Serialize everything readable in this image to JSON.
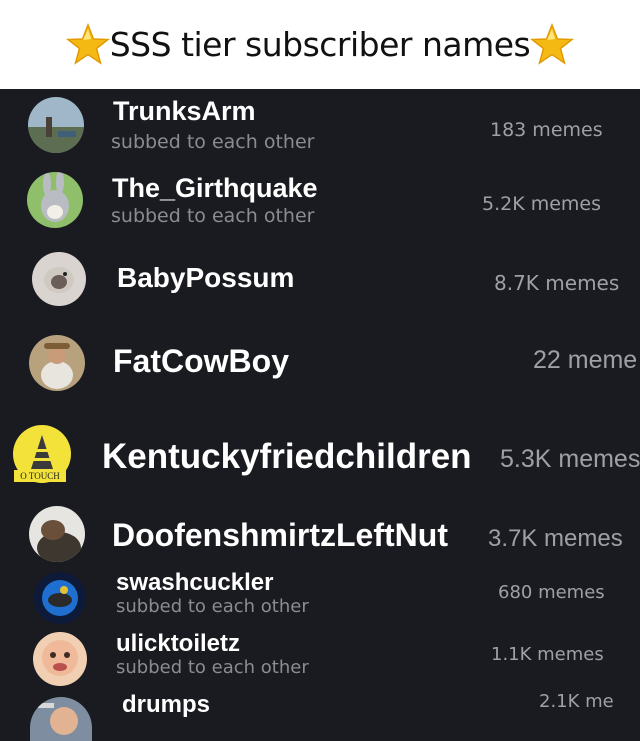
{
  "header": {
    "title": "SSS tier subscriber names"
  },
  "subscribers": [
    {
      "name": "TrunksArm",
      "subtitle": "subbed to each other",
      "count": "183 memes"
    },
    {
      "name": "The_Girthquake",
      "subtitle": "subbed to each other",
      "count": "5.2K memes"
    },
    {
      "name": "BabyPossum",
      "count": "8.7K memes"
    },
    {
      "name": "FatCowBoy",
      "count": "22 meme"
    },
    {
      "name": "Kentuckyfriedchildren",
      "count": "5.3K memes",
      "avatar_text": "O TOUCH"
    },
    {
      "name": "DoofenshmirtzLeftNut",
      "count": "3.7K memes"
    },
    {
      "name": "swashcuckler",
      "subtitle": "subbed to each other",
      "count": "680 memes"
    },
    {
      "name": "ulicktoiletz",
      "subtitle": "subbed to each other",
      "count": "1.1K memes"
    },
    {
      "name": "drumps",
      "count": "2.1K me"
    }
  ],
  "colors": {
    "background": "#1a1b20",
    "header_bg": "#ffffff",
    "name": "#ffffff",
    "muted": "#8a8c93",
    "star": "#f5b914"
  }
}
